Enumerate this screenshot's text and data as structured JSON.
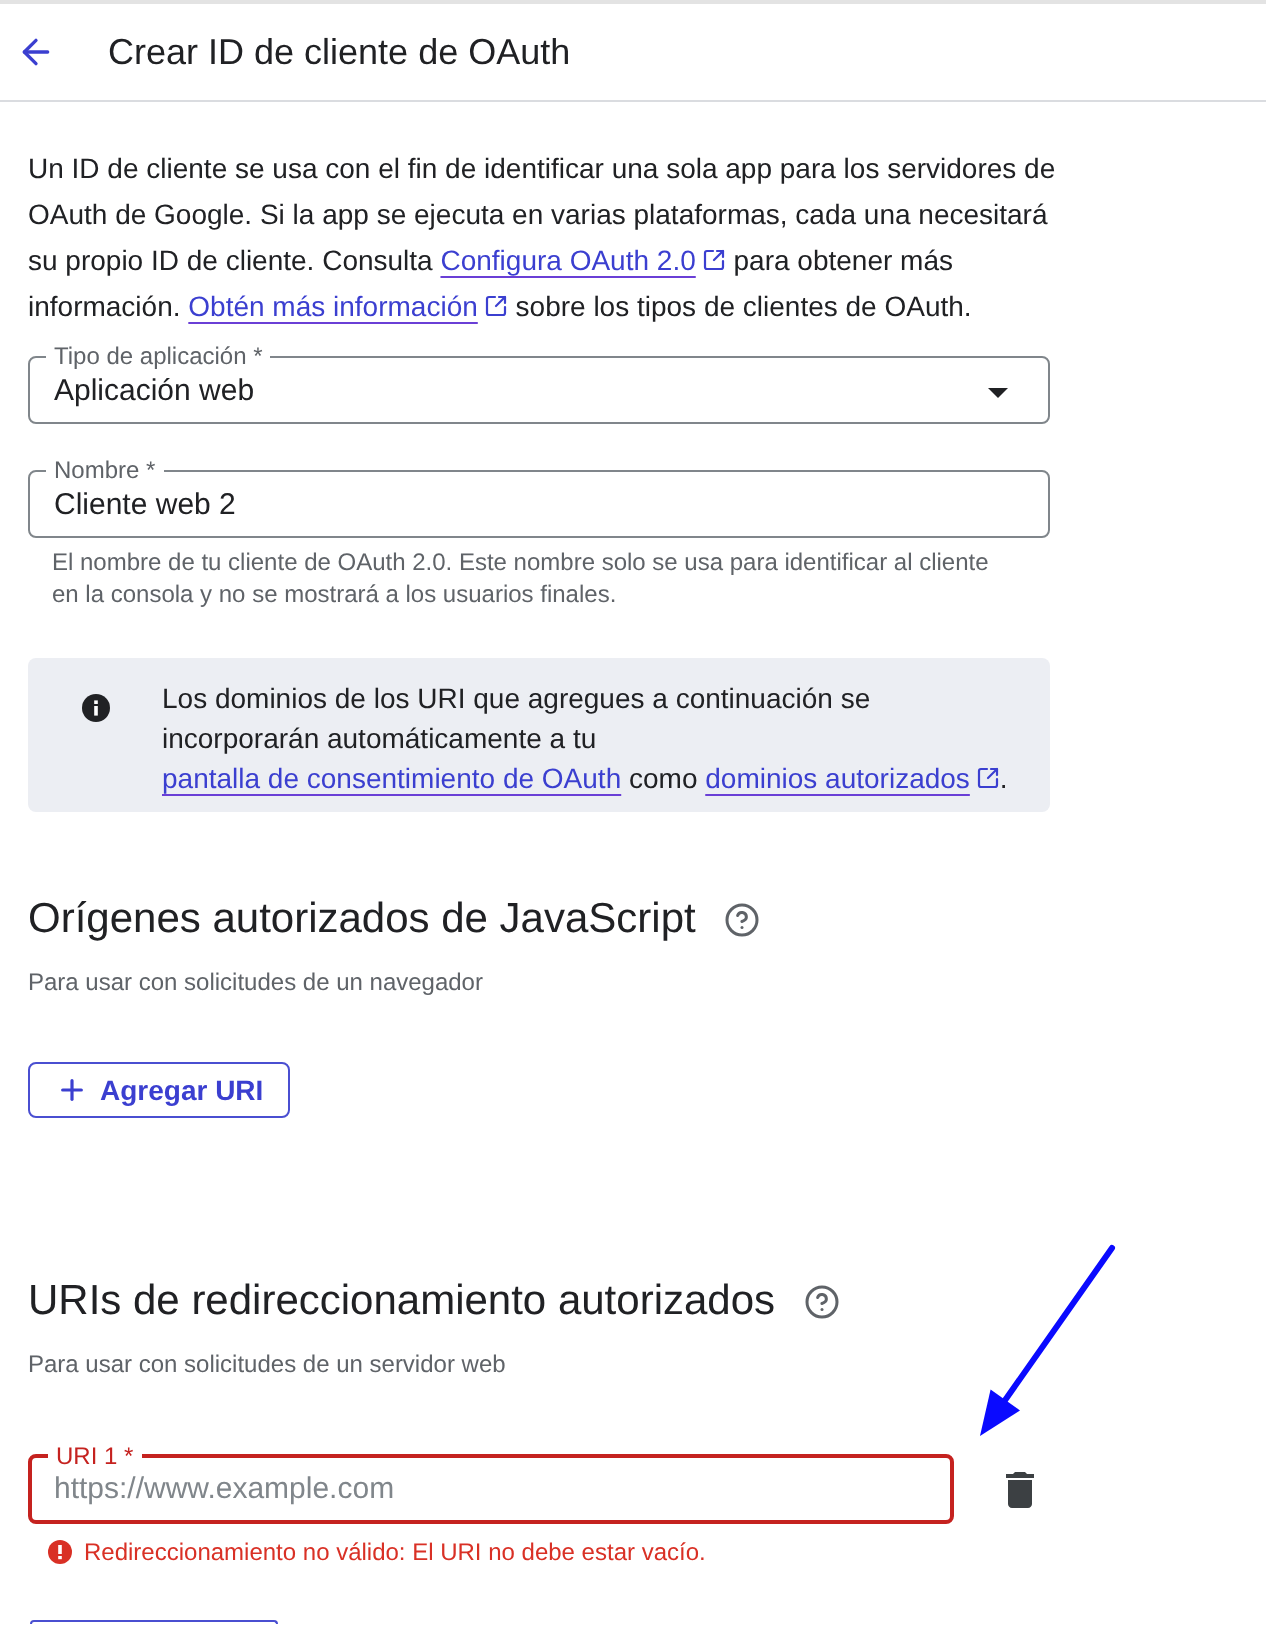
{
  "header": {
    "title": "Crear ID de cliente de OAuth"
  },
  "intro": {
    "segments": [
      {
        "kind": "text",
        "text": "Un ID de cliente se usa con el fin de identificar una sola app para los servidores de OAuth de Google. Si la app se ejecuta en varias plataformas, cada una necesitará su propio ID de cliente. Consulta "
      },
      {
        "kind": "link",
        "text": "Configura OAuth 2.0",
        "external": true
      },
      {
        "kind": "text",
        "text": " para obtener más información. "
      },
      {
        "kind": "link",
        "text": "Obtén más información",
        "external": true
      },
      {
        "kind": "text",
        "text": " sobre los tipos de clientes de OAuth."
      }
    ]
  },
  "fields": [
    {
      "kind": "select",
      "label": "Tipo de aplicación *",
      "value": "Aplicación web"
    },
    {
      "kind": "text",
      "label": "Nombre *",
      "value": "Cliente web 2",
      "hint": "El nombre de tu cliente de OAuth 2.0. Este nombre solo se usa para identificar al cliente en la consola y no se mostrará a los usuarios finales."
    }
  ],
  "notice": {
    "segments": [
      {
        "kind": "text",
        "text": "Los dominios de los URI que agregues a continuación se incorporarán automáticamente a tu "
      },
      {
        "kind": "link",
        "text": "pantalla de consentimiento de OAuth",
        "external": false
      },
      {
        "kind": "text",
        "text": " como "
      },
      {
        "kind": "link",
        "text": "dominios autorizados",
        "external": true
      },
      {
        "kind": "text",
        "text": "."
      }
    ]
  },
  "sections": [
    {
      "title": "Orígenes autorizados de JavaScript",
      "subtitle": "Para usar con solicitudes de un navegador",
      "add_button": "Agregar URI"
    },
    {
      "title": "URIs de redireccionamiento autorizados",
      "subtitle": "Para usar con solicitudes de un servidor web",
      "uris": [
        {
          "label": "URI 1 *",
          "placeholder": "https://www.example.com",
          "invalid": true,
          "error": "Redireccionamiento no válido: El URI no debe estar vacío."
        }
      ],
      "cut_off_button": true
    }
  ]
}
